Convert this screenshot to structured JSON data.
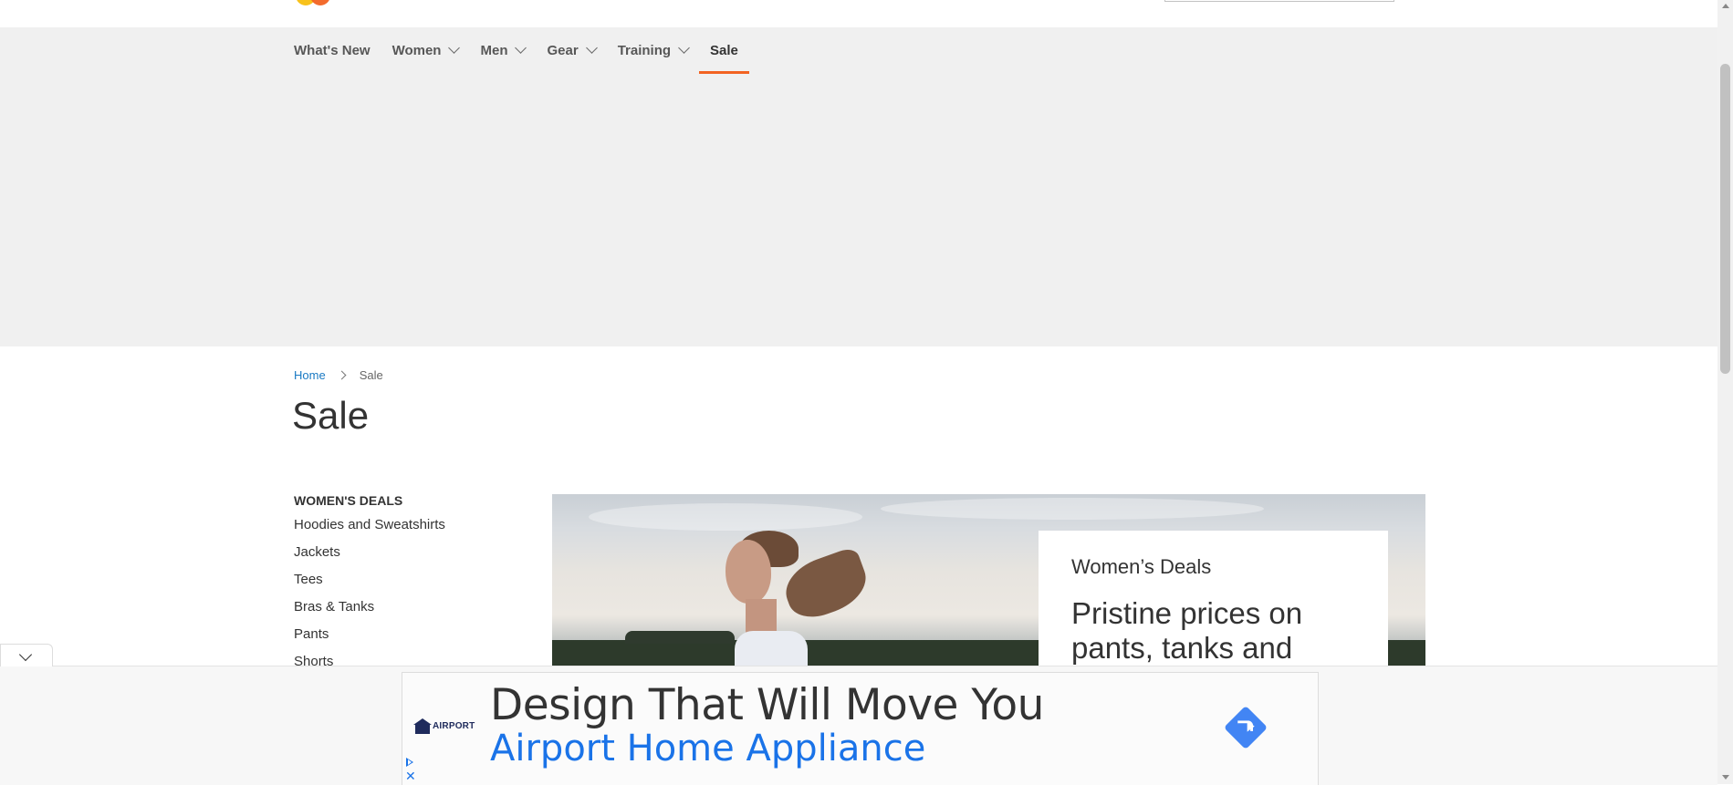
{
  "nav": {
    "items": [
      {
        "label": "What's New",
        "has_dropdown": false
      },
      {
        "label": "Women",
        "has_dropdown": true
      },
      {
        "label": "Men",
        "has_dropdown": true
      },
      {
        "label": "Gear",
        "has_dropdown": true
      },
      {
        "label": "Training",
        "has_dropdown": true
      },
      {
        "label": "Sale",
        "has_dropdown": false,
        "active": true
      }
    ],
    "active_color": "#f26322"
  },
  "breadcrumbs": {
    "home": "Home",
    "current": "Sale"
  },
  "page": {
    "title": "Sale"
  },
  "sidebar": {
    "title": "WOMEN'S DEALS",
    "items": [
      "Hoodies and Sweatshirts",
      "Jackets",
      "Tees",
      "Bras & Tanks",
      "Pants",
      "Shorts"
    ]
  },
  "hero": {
    "kicker": "Women’s Deals",
    "headline": "Pristine prices on pants, tanks and"
  },
  "ad": {
    "headline": "Design That Will Move You",
    "subline": "Airport Home Appliance",
    "advertiser_logo_text": "AIRPORT",
    "close_symbol": "✕",
    "subline_color": "#1a73e8",
    "cta_color": "#4285f4"
  },
  "colors": {
    "link": "#1979c3",
    "brand_orange": "#f26322"
  }
}
